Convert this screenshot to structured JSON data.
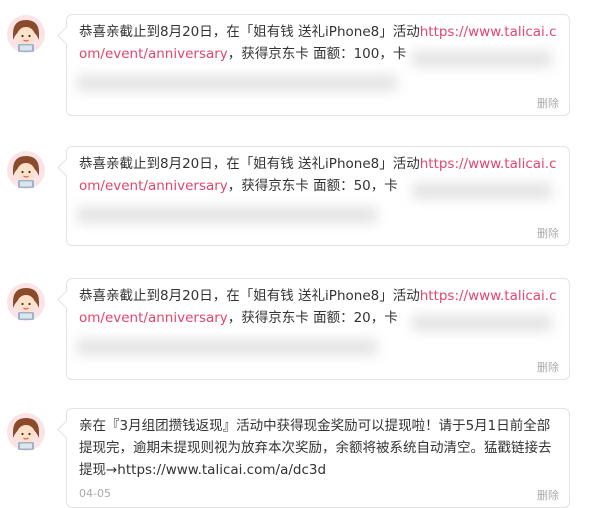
{
  "colors": {
    "link": "#e5446d",
    "border": "#e3e3e3",
    "muted": "#aaaaaa"
  },
  "messages": [
    {
      "avatar": "girl-avatar-icon",
      "prefix": "恭喜亲截止到8月20日，在「姐有钱 送礼iPhone8」活动",
      "link": "https://www.talicai.com/event/anniversary",
      "suffix": "，获得京东卡 面额：100，卡",
      "delete_label": "删除"
    },
    {
      "avatar": "girl-avatar-icon",
      "prefix": "恭喜亲截止到8月20日，在「姐有钱 送礼iPhone8」活动",
      "link": "https://www.talicai.com/event/anniversary",
      "suffix": "，获得京东卡 面额：50，卡",
      "delete_label": "删除"
    },
    {
      "avatar": "girl-avatar-icon",
      "prefix": "恭喜亲截止到8月20日，在「姐有钱 送礼iPhone8」活动",
      "link": "https://www.talicai.com/event/anniversary",
      "suffix": "，获得京东卡 面额：20，卡",
      "delete_label": "删除"
    },
    {
      "avatar": "girl-avatar-icon",
      "text": "亲在『3月组团攒钱返现』活动中获得现金奖励可以提现啦！请于5月1日前全部提现完，逾期未提现则视为放弃本次奖励，余额将被系统自动清空。猛戳链接去提现→https://www.talicai.com/a/dc3d",
      "date": "04-05",
      "delete_label": "删除"
    }
  ]
}
